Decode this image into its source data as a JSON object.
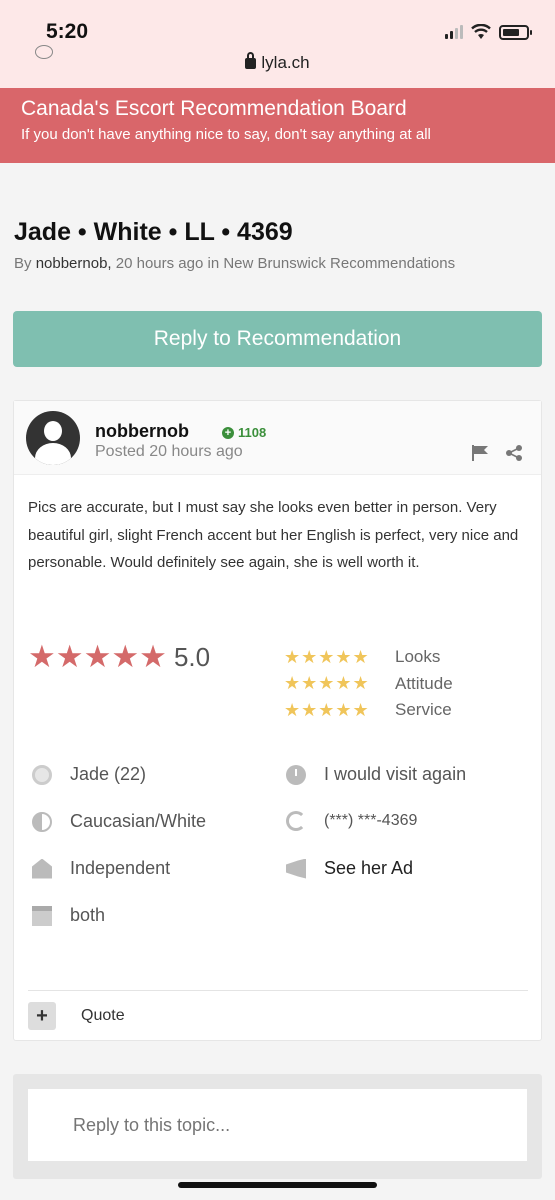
{
  "status_bar": {
    "time": "5:20",
    "url": "lyla.ch"
  },
  "site": {
    "title": "Canada's Escort Recommendation Board",
    "tagline": "If you don't have anything nice to say, don't say anything at all",
    "brand_color": "#d9666a"
  },
  "topic": {
    "title": "Jade • White • LL • 4369",
    "by_label": "By",
    "author": "nobbernob,",
    "meta_rest": "20 hours ago in New Brunswick Recommendations"
  },
  "reply_button": {
    "label": "Reply to Recommendation",
    "color": "#7fbfb0"
  },
  "post": {
    "author": "nobbernob",
    "reputation": "1108",
    "posted": "Posted 20 hours ago",
    "body": "Pics are accurate, but I must say she looks even better in person. Very beautiful girl, slight French accent but her English is perfect, very nice and personable. Would definitely see again, she is well worth it.",
    "overall_rating": "5.0",
    "stars": "★★★★★",
    "sub_ratings": [
      {
        "stars": "★★★★★",
        "label": "Looks"
      },
      {
        "stars": "★★★★★",
        "label": "Attitude"
      },
      {
        "stars": "★★★★★",
        "label": "Service"
      }
    ],
    "details": {
      "name_age": "Jade (22)",
      "ethnicity": "Caucasian/White",
      "type": "Independent",
      "availability": "both",
      "visit_again": "I would visit again",
      "phone": "(***) ***-4369",
      "ad_link": "See her Ad"
    },
    "quote_plus": "+",
    "quote_label": "Quote"
  },
  "reply_box": {
    "placeholder": "Reply to this topic..."
  }
}
